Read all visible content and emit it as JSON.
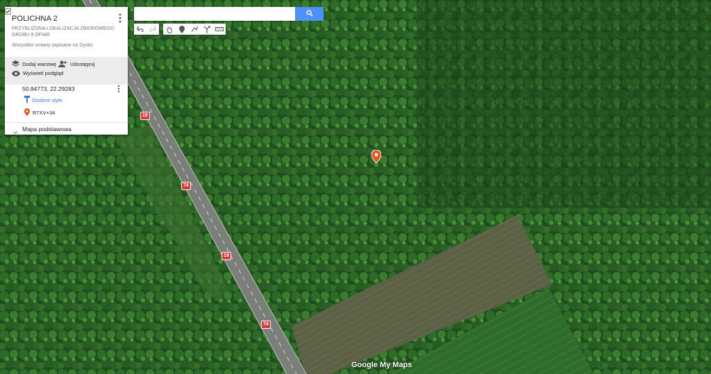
{
  "panel": {
    "title": "POLICHNA 2",
    "description": "PRZYBLIŻONA LOKALIZACJA ZBIOROWEGO GROBU 8 OFIAR",
    "saved_status": "Wszystkie zmiany zapisane na Dysku",
    "add_layer": "Dodaj warstwę",
    "share": "Udostępnij",
    "preview": "Wyświetl podgląd",
    "layer": {
      "name": "50.84773, 22.29283",
      "style": "Osobne style",
      "item": "R7XV+34"
    },
    "base_map": "Mapa podstawowa"
  },
  "search": {
    "value": "",
    "placeholder": ""
  },
  "roads": {
    "r1": "19",
    "r2": "74",
    "r3": "19",
    "r4": "74"
  },
  "logo": "Google My Maps",
  "colors": {
    "accent": "#4d90fe",
    "marker": "#e8541e",
    "link": "#3b78e7",
    "road_shield": "#d83b3b"
  },
  "icons": [
    "menu-dots-icon",
    "layers-icon",
    "add-person-icon",
    "eye-icon",
    "checkbox-icon",
    "paint-roller-icon",
    "place-marker-icon",
    "chevron-icon",
    "search-icon",
    "undo-icon",
    "redo-icon",
    "hand-icon",
    "pin-icon",
    "draw-line-icon",
    "directions-icon",
    "ruler-icon"
  ]
}
